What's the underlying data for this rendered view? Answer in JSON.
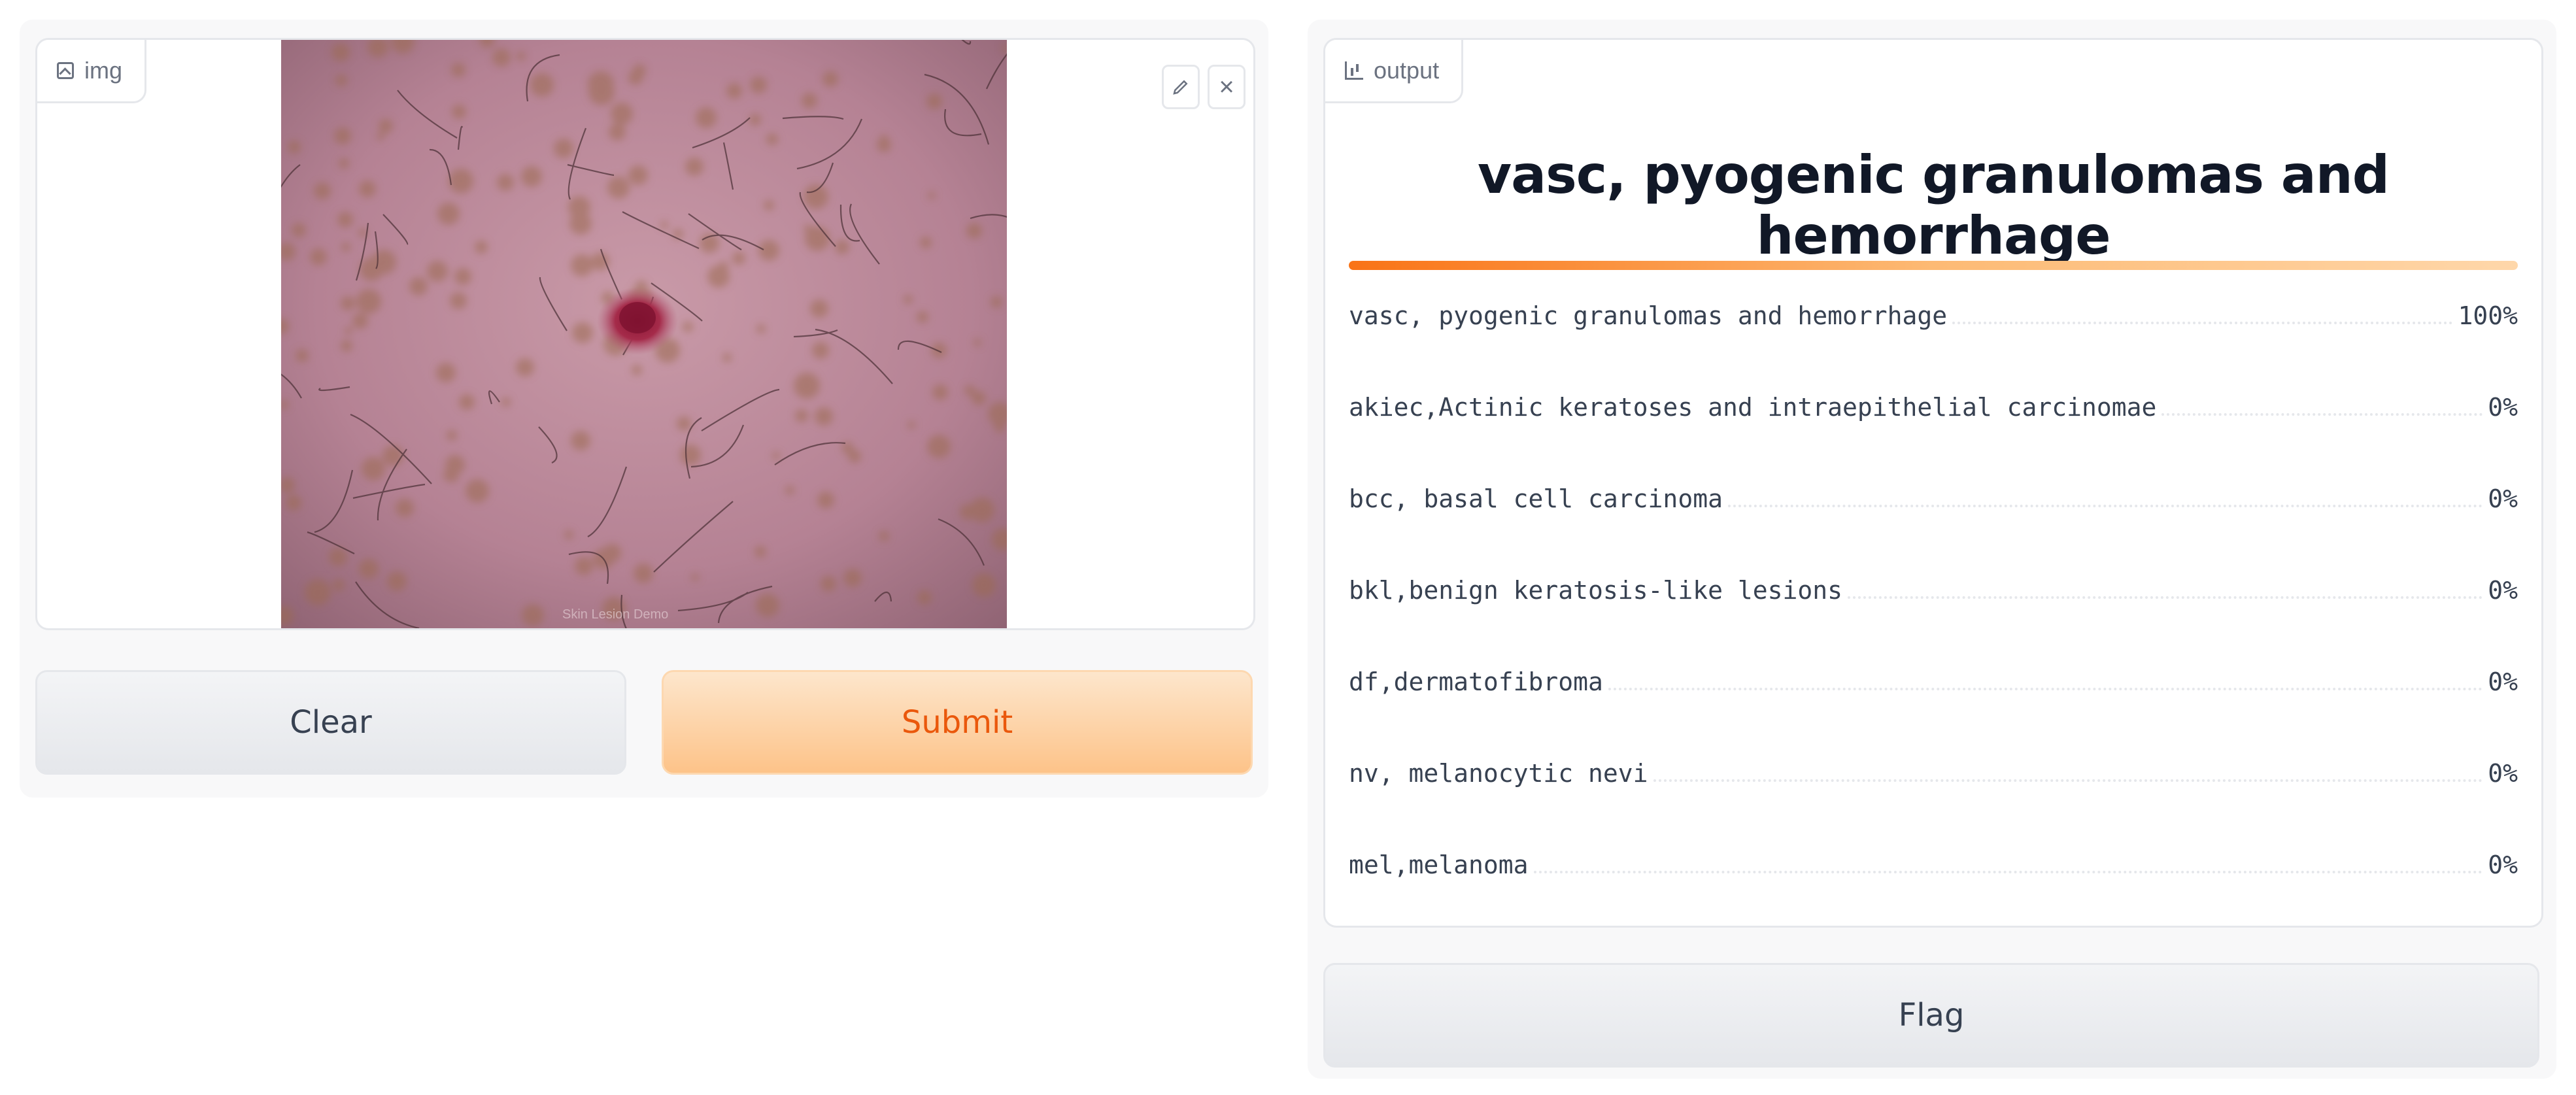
{
  "input": {
    "label": "img",
    "image_watermark": "Skin Lesion Demo",
    "edit_icon": "pencil-icon",
    "close_icon": "close-icon",
    "close_glyph": "×"
  },
  "buttons": {
    "clear": "Clear",
    "submit": "Submit",
    "flag": "Flag"
  },
  "output": {
    "label": "output",
    "top_label": "vasc, pyogenic granulomas and hemorrhage",
    "confidences": [
      {
        "label": "vasc, pyogenic granulomas and hemorrhage",
        "value": "100%"
      },
      {
        "label": "akiec,Actinic keratoses and intraepithelial carcinomae",
        "value": "0%"
      },
      {
        "label": "bcc, basal cell carcinoma",
        "value": "0%"
      },
      {
        "label": "bkl,benign keratosis-like lesions",
        "value": "0%"
      },
      {
        "label": "df,dermatofibroma",
        "value": "0%"
      },
      {
        "label": "nv, melanocytic nevi",
        "value": "0%"
      },
      {
        "label": "mel,melanoma",
        "value": "0%"
      }
    ]
  },
  "colors": {
    "accent": "#f97316",
    "submit_text": "#ea580c"
  }
}
